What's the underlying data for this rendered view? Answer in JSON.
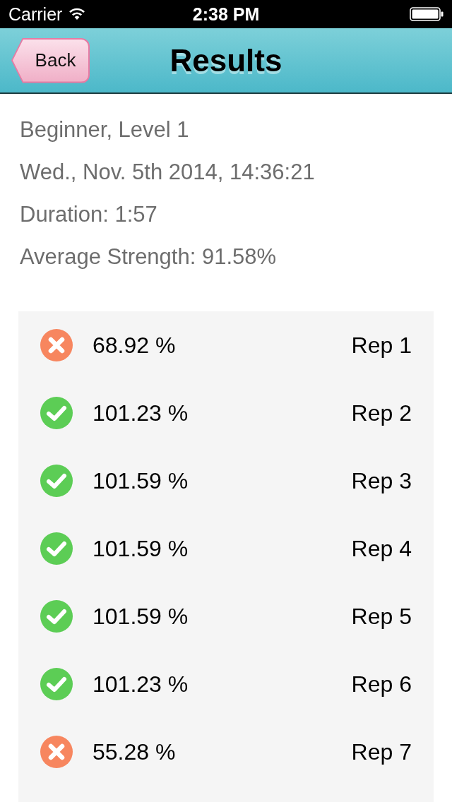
{
  "status_bar": {
    "carrier": "Carrier",
    "time": "2:38 PM"
  },
  "nav_bar": {
    "back_button": "Back",
    "title": "Results"
  },
  "summary": [
    "Beginner, Level 1",
    "Wed., Nov. 5th 2014, 14:36:21",
    "Duration: 1:57",
    "Average Strength: 91.58%"
  ],
  "reps": [
    {
      "value": "68.92 %",
      "label": "Rep 1",
      "passed": false
    },
    {
      "value": "101.23 %",
      "label": "Rep 2",
      "passed": true
    },
    {
      "value": "101.59 %",
      "label": "Rep 3",
      "passed": true
    },
    {
      "value": "101.59 %",
      "label": "Rep 4",
      "passed": true
    },
    {
      "value": "101.59 %",
      "label": "Rep 5",
      "passed": true
    },
    {
      "value": "101.23 %",
      "label": "Rep 6",
      "passed": true
    },
    {
      "value": "55.28 %",
      "label": "Rep 7",
      "passed": false
    }
  ]
}
